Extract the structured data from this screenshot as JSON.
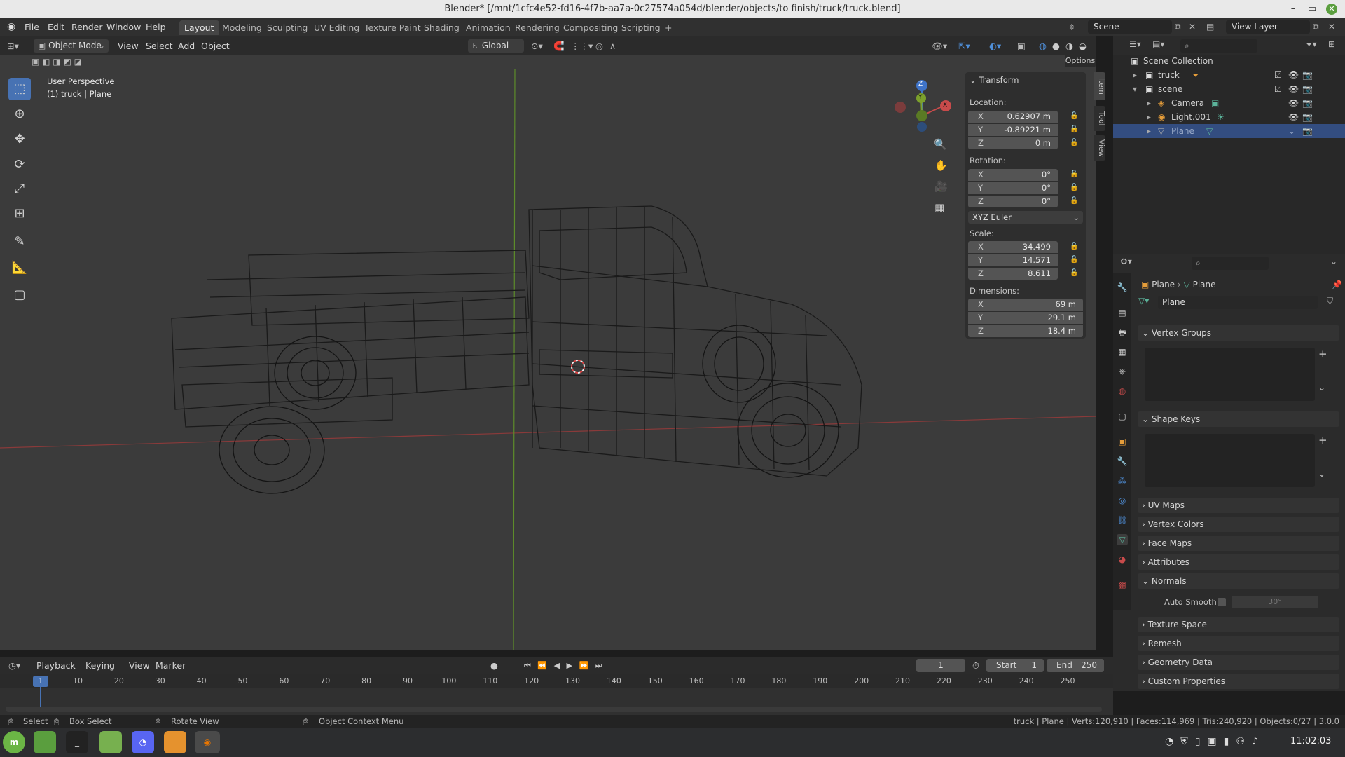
{
  "window": {
    "title": "Blender* [/mnt/1cfc4e52-fd16-4f7b-aa7a-0c27574a054d/blender/objects/to finish/truck/truck.blend]"
  },
  "menubar": {
    "menus": [
      "File",
      "Edit",
      "Render",
      "Window",
      "Help"
    ],
    "workspaces": [
      "Layout",
      "Modeling",
      "Sculpting",
      "UV Editing",
      "Texture Paint",
      "Shading",
      "Animation",
      "Rendering",
      "Compositing",
      "Scripting"
    ],
    "add_tab": "+",
    "scene": "Scene",
    "view_layer": "View Layer"
  },
  "viewport_header": {
    "mode": "Object Mode",
    "menus": [
      "View",
      "Select",
      "Add",
      "Object"
    ],
    "orientation": "Global",
    "options": "Options"
  },
  "viewport": {
    "perspective": "User Perspective",
    "context": "(1) truck | Plane",
    "gizmo_axes": [
      "Z",
      "Y",
      "X"
    ],
    "side_tabs": [
      "Item",
      "Tool",
      "View"
    ]
  },
  "transform": {
    "title": "Transform",
    "location_label": "Location:",
    "location": [
      {
        "axis": "X",
        "value": "0.62907 m"
      },
      {
        "axis": "Y",
        "value": "-0.89221 m"
      },
      {
        "axis": "Z",
        "value": "0 m"
      }
    ],
    "rotation_label": "Rotation:",
    "rotation": [
      {
        "axis": "X",
        "value": "0°"
      },
      {
        "axis": "Y",
        "value": "0°"
      },
      {
        "axis": "Z",
        "value": "0°"
      }
    ],
    "rotation_mode": "XYZ Euler",
    "scale_label": "Scale:",
    "scale": [
      {
        "axis": "X",
        "value": "34.499"
      },
      {
        "axis": "Y",
        "value": "14.571"
      },
      {
        "axis": "Z",
        "value": "8.611"
      }
    ],
    "dimensions_label": "Dimensions:",
    "dimensions": [
      {
        "axis": "X",
        "value": "69 m"
      },
      {
        "axis": "Y",
        "value": "29.1 m"
      },
      {
        "axis": "Z",
        "value": "18.4 m"
      }
    ]
  },
  "outliner": {
    "root": "Scene Collection",
    "items": [
      {
        "label": "truck"
      },
      {
        "label": "scene"
      },
      {
        "label": "Camera"
      },
      {
        "label": "Light.001"
      },
      {
        "label": "Plane"
      }
    ]
  },
  "properties": {
    "breadcrumb_object": "Plane",
    "breadcrumb_data": "Plane",
    "datablock": "Plane",
    "sections": [
      "Vertex Groups",
      "Shape Keys",
      "UV Maps",
      "Vertex Colors",
      "Face Maps",
      "Attributes",
      "Normals",
      "Texture Space",
      "Remesh",
      "Geometry Data",
      "Custom Properties"
    ],
    "auto_smooth_label": "Auto Smooth",
    "auto_smooth_angle": "30°"
  },
  "timeline": {
    "menus": [
      "Playback",
      "Keying",
      "View",
      "Marker"
    ],
    "current_frame": "1",
    "start_label": "Start",
    "start": "1",
    "end_label": "End",
    "end": "250",
    "ticks": [
      "1",
      "10",
      "20",
      "30",
      "40",
      "50",
      "60",
      "70",
      "80",
      "90",
      "100",
      "110",
      "120",
      "130",
      "140",
      "150",
      "160",
      "170",
      "180",
      "190",
      "200",
      "210",
      "220",
      "230",
      "240",
      "250"
    ]
  },
  "statusbar": {
    "select": "Select",
    "box_select": "Box Select",
    "rotate_view": "Rotate View",
    "context_menu": "Object Context Menu",
    "stats": "truck | Plane | Verts:120,910 | Faces:114,969 | Tris:240,920 | Objects:0/27 | 3.0.0"
  },
  "taskbar": {
    "time": "11:02:03"
  },
  "colors": {
    "accent": "#4772b3",
    "x_axis": "#c84b4b",
    "y_axis": "#7ca02c",
    "z_axis": "#3f74c9"
  }
}
